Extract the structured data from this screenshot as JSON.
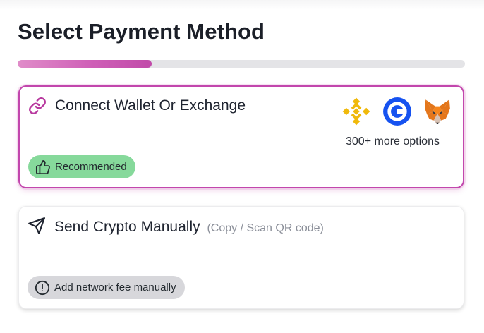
{
  "page": {
    "title": "Select Payment Method",
    "progress_fraction": 0.3
  },
  "wallet_option": {
    "label": "Connect Wallet Or Exchange",
    "icon": "link-icon",
    "providers": [
      "binance-logo",
      "coinbase-logo",
      "metamask-logo"
    ],
    "more_options": "300+ more options",
    "badge": "Recommended",
    "badge_icon": "thumbs-up-icon",
    "selected": true,
    "accent_color": "#c246ad"
  },
  "manual_option": {
    "label": "Send Crypto Manually",
    "sublabel": "(Copy / Scan QR code)",
    "icon": "send-icon",
    "badge": "Add network fee manually",
    "badge_icon": "alert-circle-icon"
  },
  "colors": {
    "badge_green": "#86d99b",
    "badge_gray": "#d7d7db",
    "progress": "#cf5fb7"
  }
}
